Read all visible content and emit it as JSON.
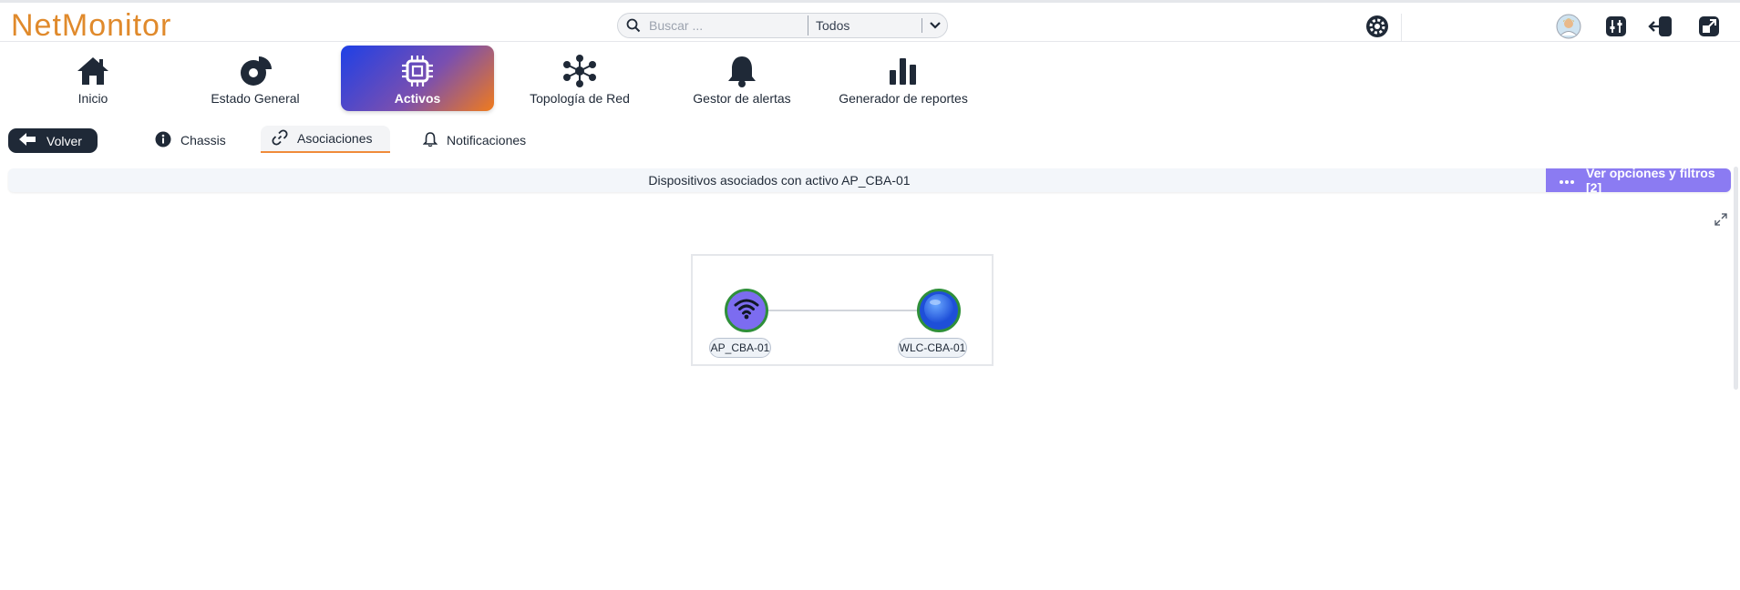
{
  "app": {
    "title": "NetMonitor"
  },
  "colors": {
    "brand": "#e08a2c",
    "accent": "#8b7bf2",
    "node_border": "#2f8f3a",
    "tab_underline": "#f08b3a"
  },
  "search": {
    "placeholder": "Buscar ...",
    "filter_value": "Todos",
    "icon": "search-icon"
  },
  "header_icons": [
    "gear-icon",
    "avatar",
    "sliders-icon",
    "logout-icon",
    "external-link-icon"
  ],
  "nav": {
    "items": [
      {
        "label": "Inicio",
        "icon": "home-icon"
      },
      {
        "label": "Estado General",
        "icon": "pie-chart-icon"
      },
      {
        "label": "Activos",
        "icon": "chip-icon",
        "active": true
      },
      {
        "label": "Topología de Red",
        "icon": "network-icon"
      },
      {
        "label": "Gestor de alertas",
        "icon": "bell-icon"
      },
      {
        "label": "Generador de reportes",
        "icon": "bar-chart-icon"
      }
    ]
  },
  "subtabs": {
    "back_label": "Volver",
    "items": [
      {
        "label": "Chassis",
        "icon": "info-icon"
      },
      {
        "label": "Asociaciones",
        "icon": "link-icon",
        "active": true
      },
      {
        "label": "Notificaciones",
        "icon": "bell-icon"
      }
    ]
  },
  "info_bar": {
    "title": "Dispositivos asociados con activo AP_CBA-01",
    "options_label": "Ver opciones y filtros [2]"
  },
  "graph": {
    "nodes": [
      {
        "label": "AP_CBA-01",
        "icon": "wifi-icon"
      },
      {
        "label": "WLC-CBA-01",
        "icon": "controller-icon"
      }
    ]
  }
}
